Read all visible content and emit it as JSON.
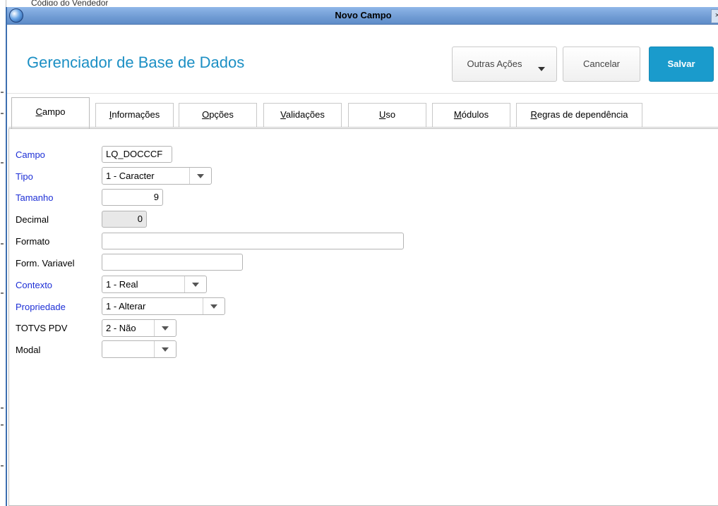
{
  "background": {
    "behind_text": "Código do Vendedor"
  },
  "window": {
    "title": "Novo Campo",
    "close": "×"
  },
  "header": {
    "app_title": "Gerenciador de Base de Dados",
    "btn_outras": "Outras Ações",
    "btn_cancelar": "Cancelar",
    "btn_salvar": "Salvar",
    "accent": "#1a9bcc"
  },
  "tabs": [
    {
      "label": "Campo",
      "hotkey": "C",
      "rest": "ampo",
      "active": true
    },
    {
      "label": "Informações",
      "hotkey": "I",
      "rest": "nformações"
    },
    {
      "label": "Opções",
      "hotkey": "O",
      "rest": "pções"
    },
    {
      "label": "Validações",
      "hotkey": "V",
      "rest": "alidações"
    },
    {
      "label": "Uso",
      "hotkey": "U",
      "rest": "so"
    },
    {
      "label": "Módulos",
      "hotkey": "M",
      "rest": "ódulos"
    },
    {
      "label": "Regras de dependência",
      "hotkey": "R",
      "rest": "egras de dependência"
    }
  ],
  "form": {
    "campo": {
      "label": "Campo",
      "value": "LQ_DOCCCF"
    },
    "tipo": {
      "label": "Tipo",
      "value": "1 - Caracter"
    },
    "tamanho": {
      "label": "Tamanho",
      "value": "9"
    },
    "decimal": {
      "label": "Decimal",
      "value": "0"
    },
    "formato": {
      "label": "Formato",
      "value": ""
    },
    "form_variavel": {
      "label": "Form. Variavel",
      "value": ""
    },
    "contexto": {
      "label": "Contexto",
      "value": "1 - Real"
    },
    "propriedade": {
      "label": "Propriedade",
      "value": "1 - Alterar"
    },
    "totvs_pdv": {
      "label": "TOTVS PDV",
      "value": "2 - Não"
    },
    "modal": {
      "label": "Modal",
      "value": ""
    }
  }
}
